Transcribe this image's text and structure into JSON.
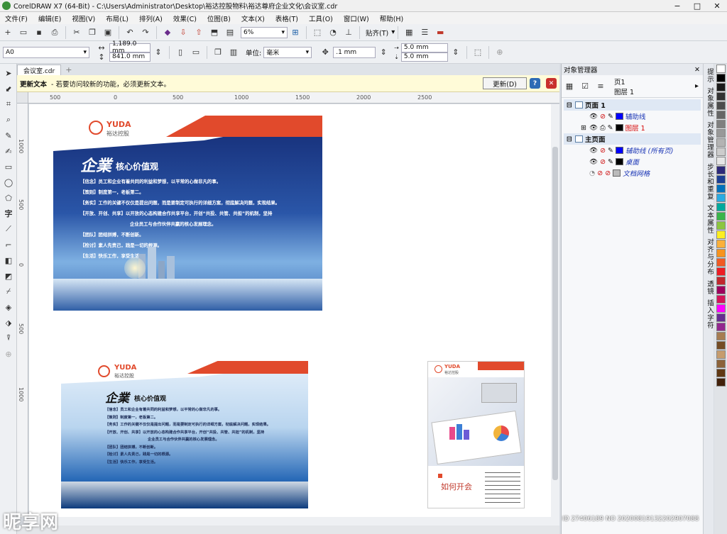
{
  "window": {
    "title": "CorelDRAW X7 (64-Bit) - C:\\Users\\Administrator\\Desktop\\裕达控股物料\\裕达尊府企业文化\\会议室.cdr"
  },
  "menu": [
    "文件(F)",
    "编辑(E)",
    "视图(V)",
    "布局(L)",
    "排列(A)",
    "效果(C)",
    "位图(B)",
    "文本(X)",
    "表格(T)",
    "工具(O)",
    "窗口(W)",
    "帮助(H)"
  ],
  "toolbar": {
    "zoom": "6%",
    "snap": "贴齐(T)"
  },
  "propbar": {
    "paper": "A0",
    "width": "1,189.0 mm",
    "height": "841.0 mm",
    "unit_label": "单位:",
    "unit": "毫米",
    "nudge": ".1 mm",
    "dup_x": "5.0 mm",
    "dup_y": "5.0 mm"
  },
  "doc_tab": "会议室.cdr",
  "notice": {
    "title": "更新文本",
    "text": "- 若要访问较新的功能，必须更新文本。",
    "button": "更新(D)"
  },
  "hruler": [
    "500",
    "0",
    "500",
    "1000",
    "1500",
    "2000",
    "2500"
  ],
  "vruler": [
    "1000",
    "500",
    "0",
    "500",
    "1000"
  ],
  "boards": {
    "brand_en": "YUDA",
    "brand_cn": "裕达控股",
    "headline_big": "企業",
    "headline": "核心价值观",
    "lines": [
      "【信念】员工和企业有着共同的利益和梦想，以平常的心做非凡的事。",
      "【策则】制度第一，老板第二。",
      "【务实】工作的关键不仅仅是提出问题，而是要制定可执行的详细方案，彻底解决问题，实现结果。",
      "【开放、开创、共享】以开放的心态构建合作共享平台，开创“共投、共管、共担”的机制，坚持",
      "企业员工与合作伙伴共赢的核心发展理念。",
      "【团队】团结拼搏，不断创新。",
      "【检讨】素人先责己，践是一切的根源。",
      "【生活】快乐工作，享受生活。"
    ],
    "meeting_title": "如何开会"
  },
  "object_manager": {
    "title": "对象管理器",
    "page_label": "页1",
    "layer_label": "图层 1",
    "rows": [
      {
        "label": "页面 1",
        "kind": "page"
      },
      {
        "label": "辅助线",
        "kind": "layer",
        "color": "#0000ff"
      },
      {
        "label": "图层 1",
        "kind": "layer-active",
        "color": "#000000"
      },
      {
        "label": "主页面",
        "kind": "page"
      },
      {
        "label": "辅助线 (所有页)",
        "kind": "layer",
        "color": "#0000ff"
      },
      {
        "label": "桌面",
        "kind": "layer",
        "color": "#000000"
      },
      {
        "label": "文档网格",
        "kind": "layer",
        "color": "#bbbbbb"
      }
    ]
  },
  "side_tabs": [
    "提示",
    "对象属性",
    "对象管理器",
    "步长和重复",
    "文本属性",
    "对齐与分布",
    "透镜",
    "插入字符"
  ],
  "palette": [
    "#ffffff",
    "#000000",
    "#1a1a1a",
    "#333333",
    "#4d4d4d",
    "#666666",
    "#808080",
    "#999999",
    "#b3b3b3",
    "#cccccc",
    "#e6e6e6",
    "#2e2a7a",
    "#1c3f94",
    "#0071bc",
    "#29abe2",
    "#00a99d",
    "#39b54a",
    "#8cc63f",
    "#fcee21",
    "#fbb03b",
    "#f7931e",
    "#f15a24",
    "#ed1c24",
    "#c1272d",
    "#9e005d",
    "#d4145a",
    "#ff00ff",
    "#662d91",
    "#93278f",
    "#a67c52",
    "#754c24",
    "#c69c6d",
    "#8c6239",
    "#603813",
    "#42210b"
  ],
  "status": {
    "hint": "ID 27406189 NO 20200819132202907088"
  },
  "watermark": "昵享网"
}
